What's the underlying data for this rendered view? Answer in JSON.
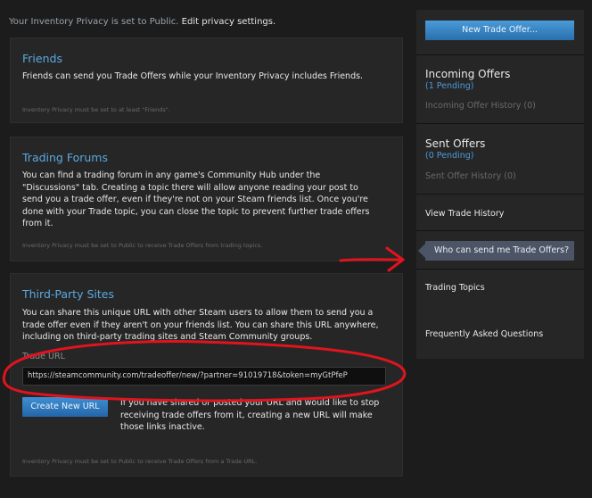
{
  "privacy": {
    "text": "Your Inventory Privacy is set to Public.",
    "edit_link": "Edit privacy settings."
  },
  "friends": {
    "title": "Friends",
    "body": "Friends can send you Trade Offers while your Inventory Privacy includes Friends.",
    "note": "Inventory Privacy must be set to at least \"Friends\"."
  },
  "forums": {
    "title": "Trading Forums",
    "body": "You can find a trading forum in any game's Community Hub under the \"Discussions\" tab. Creating a topic there will allow anyone reading your post to send you a trade offer, even if they're not on your Steam friends list. Once you're done with your Trade topic, you can close the topic to prevent further trade offers from it.",
    "note": "Inventory Privacy must be set to Public to receive Trade Offers from trading topics."
  },
  "third_party": {
    "title": "Third-Party Sites",
    "body": "You can share this unique URL with other Steam users to allow them to send you a trade offer even if they aren't on your friends list. You can share this URL anywhere, including on third-party trading sites and Steam Community groups.",
    "url_label": "Trade URL",
    "url_value": "https://steamcommunity.com/tradeoffer/new/?partner=91019718&token=myGtPfeP",
    "create_button": "Create New URL",
    "create_text": "If you have shared or posted your URL and would like to stop receiving trade offers from it, creating a new URL will make those links inactive.",
    "note": "Inventory Privacy must be set to Public to receive Trade Offers from a Trade URL."
  },
  "sidebar": {
    "new_offer": "New Trade Offer...",
    "incoming": {
      "title": "Incoming Offers",
      "pending": "(1 Pending)",
      "history": "Incoming Offer History (0)"
    },
    "sent": {
      "title": "Sent Offers",
      "pending": "(0 Pending)",
      "history": "Sent Offer History (0)"
    },
    "view_history": "View Trade History",
    "who_can_send": "Who can send me Trade Offers?",
    "trading_topics": "Trading Topics",
    "faq": "Frequently Asked Questions"
  },
  "colors": {
    "background": "#1c1c1c",
    "panel": "#262626",
    "accent_blue": "#5aa9e0",
    "button_blue": "#2a6fad",
    "annotation_red": "#e0141e"
  },
  "icons": {
    "annotation_arrow": "red-arrow-icon",
    "annotation_circle": "red-circle-annotation"
  }
}
